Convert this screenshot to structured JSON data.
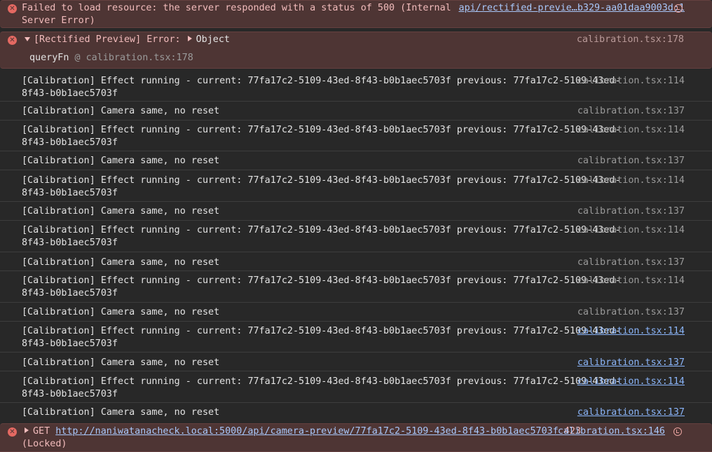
{
  "entries": {
    "e0": {
      "line1": "Failed to load resource: the server responded with a status of 500 (Internal",
      "line2": "Server Error)",
      "source": "api/rectified-previe…b329-aa01daa9003d:1"
    },
    "e1": {
      "prefix": "[Rectified Preview] Error:",
      "object": "Object",
      "stack_fn": "queryFn",
      "stack_at": "@",
      "stack_src": "calibration.tsx:178",
      "source": "calibration.tsx:178"
    },
    "effect_line1": "[Calibration] Effect running - current: 77fa17c2-5109-43ed-8f43-b0b1aec5703f previous: 77fa17c2-5109-43ed-",
    "effect_line2": "8f43-b0b1aec5703f",
    "same_text": "[Calibration] Camera same, no reset",
    "src114": "calibration.tsx:114",
    "src137": "calibration.tsx:137",
    "last": {
      "method": "GET",
      "url": "http://naniwatanacheck.local:5000/api/camera-preview/77fa17c2-5109-43ed-8f43-b0b1aec5703f",
      "status": "423",
      "status_text": "(Locked)",
      "source": "calibration.tsx:146"
    }
  },
  "icons": {
    "error": "✕",
    "retry": "network-retry-icon"
  },
  "colors": {
    "error_bg": "#4e3534",
    "error_text": "#f2bcbc",
    "error_icon": "#e46962",
    "link": "#8ab4f8",
    "source_dim": "#9a9a9a",
    "background": "#282828"
  }
}
